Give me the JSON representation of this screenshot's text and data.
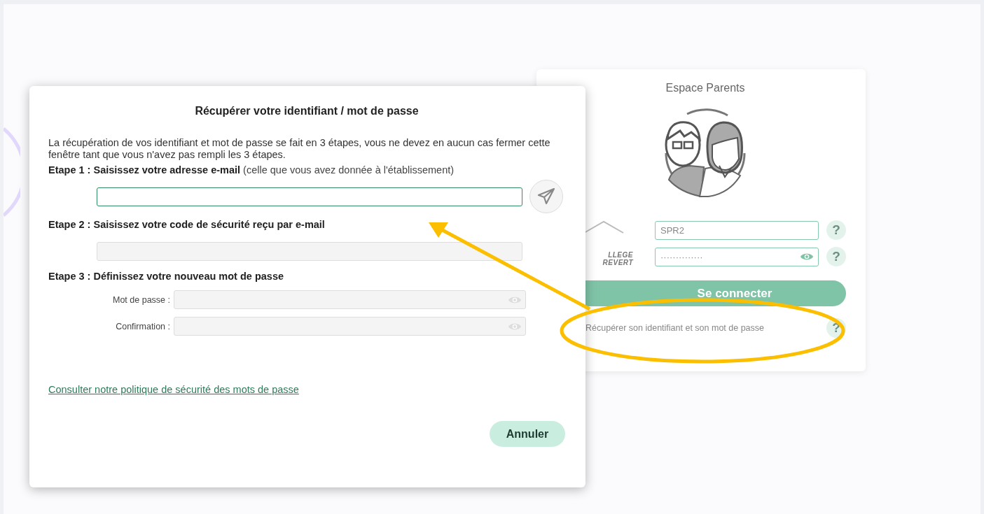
{
  "login_card": {
    "title": "Espace Parents",
    "logo": {
      "line_1": "LLEGE",
      "line_2": "REVERT"
    },
    "fields": [
      {
        "kind": "text",
        "value": "SPR2",
        "help": "?"
      },
      {
        "kind": "password",
        "value": "··············",
        "help": "?"
      }
    ],
    "login_button": "Se connecter",
    "recover_link": "Récupérer son identifiant et son mot de passe",
    "recover_help": "?"
  },
  "dialog": {
    "title": "Récupérer votre identifiant / mot de passe",
    "intro": "La récupération de vos identifiant et mot de passe se fait en 3 étapes, vous ne devez en aucun cas fermer cette fenêtre tant que vous n'avez pas rempli les 3 étapes.",
    "step_1": {
      "label": "Etape 1 : Saisissez votre adresse e-mail",
      "hint": "(celle que vous avez donnée à l'établissement)",
      "field": {
        "disabled": false
      }
    },
    "step_2": {
      "label": "Etape 2 : Saisissez votre code de sécurité reçu par e-mail",
      "field": {
        "disabled": true
      }
    },
    "step_3": {
      "label": "Etape 3 : Définissez votre nouveau mot de passe",
      "fields": [
        {
          "label": "Mot de passe :",
          "disabled": true
        },
        {
          "label": "Confirmation :",
          "disabled": true
        }
      ]
    },
    "policy_link": "Consulter notre politique de sécurité des mots de passe",
    "cancel_button": "Annuler"
  }
}
